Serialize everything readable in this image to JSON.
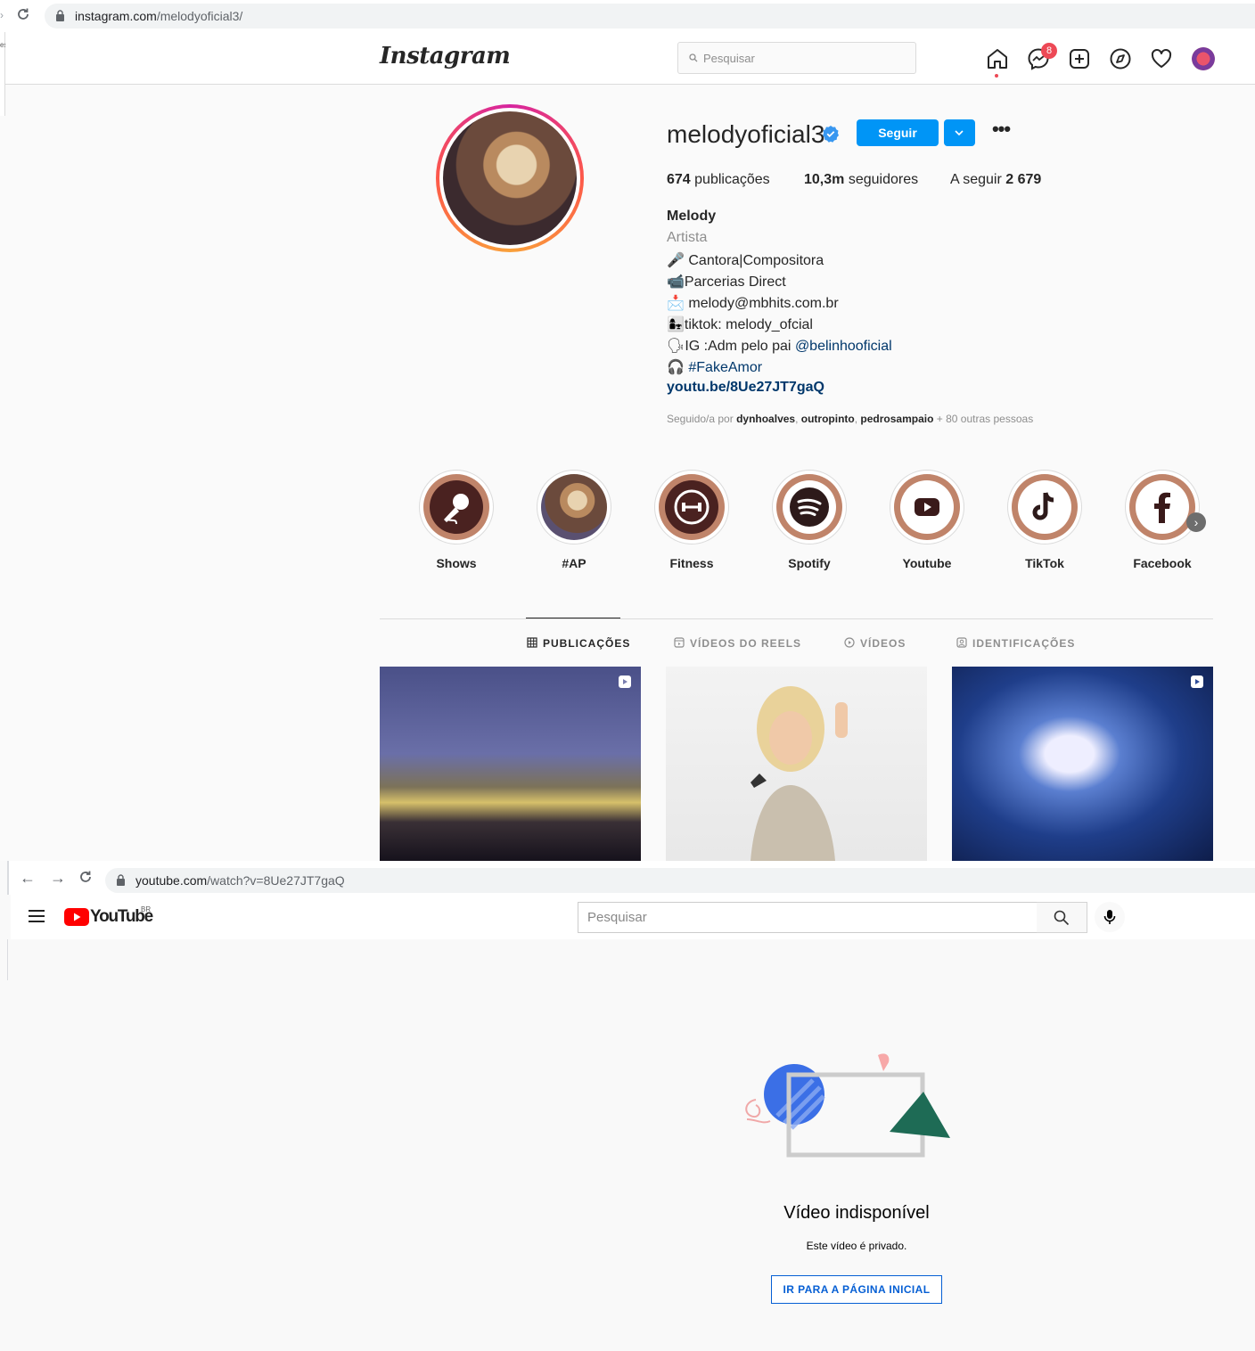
{
  "instagram_browser": {
    "url_host": "instagram.com",
    "url_path": "/melodyoficial3/",
    "edge_fragment": "es"
  },
  "ig_nav": {
    "logo": "Instagram",
    "search_placeholder": "Pesquisar",
    "messages_badge": "8"
  },
  "profile": {
    "username": "melodyoficial3",
    "follow_label": "Seguir",
    "posts_count": "674",
    "posts_label": " publicações",
    "followers_count": "10,3m",
    "followers_label": " seguidores",
    "following_label": "A seguir ",
    "following_count": "2 679",
    "name": "Melody",
    "category": "Artista",
    "bio_lines": [
      "🎤 Cantora|Compositora",
      "📹Parcerias Direct",
      "📩 melody@mbhits.com.br",
      "👩‍👧tiktok: melody_ofcial",
      "🗣IG :Adm pelo pai ",
      "🎧 "
    ],
    "bio_mention": "@belinhooficial",
    "bio_hashtag": "#FakeAmor",
    "bio_url": "youtu.be/8Ue27JT7gaQ",
    "followed_by_prefix": "Seguido/a por ",
    "followed_by_names": [
      "dynhoalves",
      "outropinto",
      "pedrosampaio"
    ],
    "followed_by_suffix": " + 80 outras pessoas"
  },
  "highlights": [
    {
      "label": "Shows",
      "icon": "microphone-icon"
    },
    {
      "label": "#AP",
      "icon": "photo"
    },
    {
      "label": "Fitness",
      "icon": "dumbbell-icon"
    },
    {
      "label": "Spotify",
      "icon": "spotify-icon"
    },
    {
      "label": "Youtube",
      "icon": "youtube-icon"
    },
    {
      "label": "TikTok",
      "icon": "tiktok-icon"
    },
    {
      "label": "Facebook",
      "icon": "facebook-icon"
    }
  ],
  "tabs": [
    {
      "label": "PUBLICAÇÕES",
      "active": true
    },
    {
      "label": "VÍDEOS DO REELS",
      "active": false
    },
    {
      "label": "VÍDEOS",
      "active": false
    },
    {
      "label": "IDENTIFICAÇÕES",
      "active": false
    }
  ],
  "colors": {
    "ig_blue": "#0095f6",
    "ig_badge": "#ed4956",
    "yt_red": "#ff0000",
    "yt_link_blue": "#065fd4"
  },
  "youtube_browser": {
    "url_host": "youtube.com",
    "url_path": "/watch?v=8Ue27JT7gaQ"
  },
  "yt_header": {
    "logo": "YouTube",
    "region": "BR",
    "search_placeholder": "Pesquisar"
  },
  "yt_error": {
    "title": "Vídeo indisponível",
    "subtitle": "Este vídeo é privado.",
    "button": "IR PARA A PÁGINA INICIAL"
  }
}
